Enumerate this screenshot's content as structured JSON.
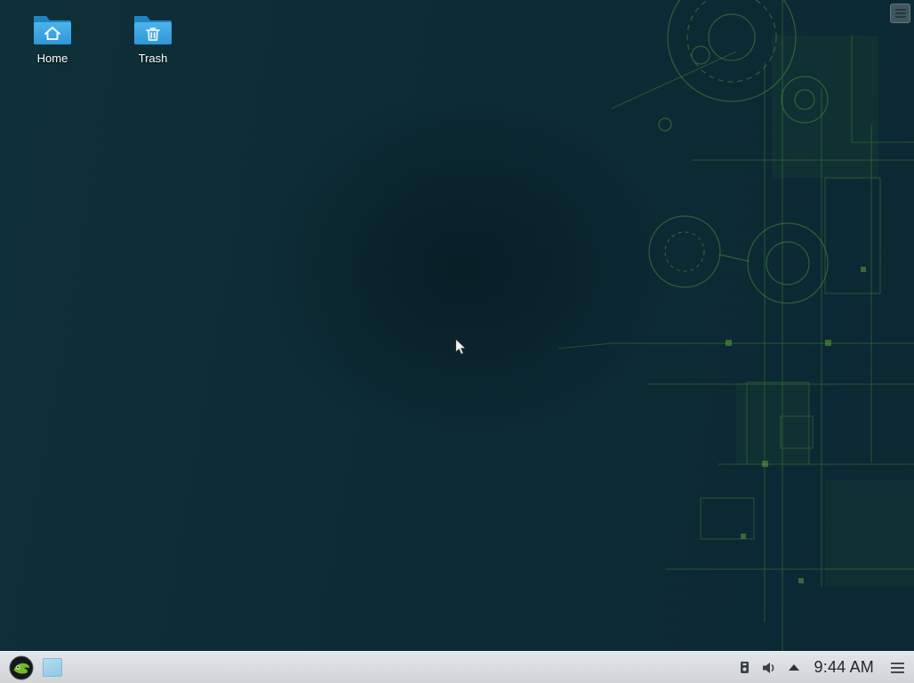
{
  "desktop": {
    "icons": [
      {
        "label": "Home",
        "icon": "folder-home-icon"
      },
      {
        "label": "Trash",
        "icon": "trash-icon"
      }
    ],
    "toolbox_icon": "hamburger-menu-icon"
  },
  "taskbar": {
    "launcher_icon": "opensuse-logo",
    "pager_icon": "desktop-pager-icon",
    "system_tray": {
      "device_notifier_icon": "device-notifier-icon",
      "volume_icon": "audio-volume-icon",
      "expand_arrow_icon": "caret-up-icon"
    },
    "clock": {
      "time": "9:44 AM"
    },
    "panel_menu_icon": "hamburger-menu-icon"
  },
  "colors": {
    "desktop_bg": "#0c2b35",
    "pattern_green": "#5da23b",
    "taskbar_bg": "#d7dadc",
    "folder_blue": "#3daee9",
    "suse_green": "#73ba25"
  }
}
